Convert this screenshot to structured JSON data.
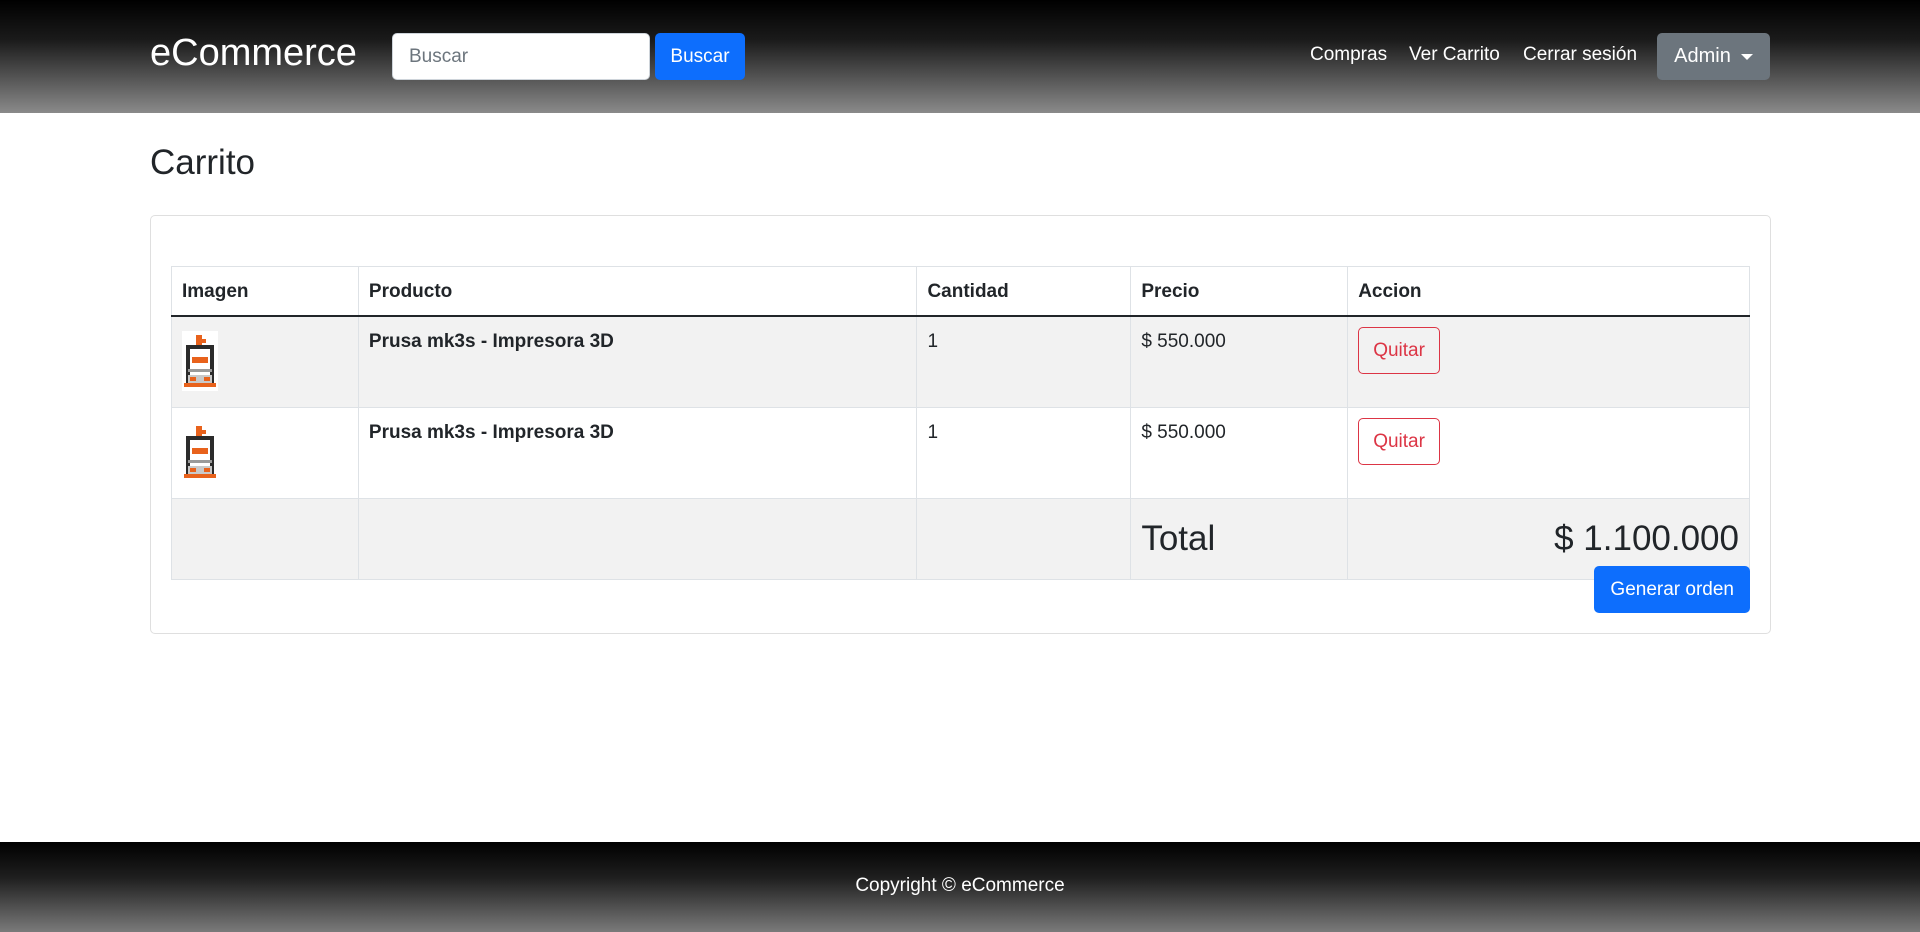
{
  "header": {
    "brand": "eCommerce",
    "search": {
      "placeholder": "Buscar",
      "value": "",
      "button_label": "Buscar"
    },
    "nav": {
      "purchases": "Compras",
      "view_cart": "Ver Carrito",
      "logout": "Cerrar sesión",
      "user_menu": "Admin"
    }
  },
  "page": {
    "title": "Carrito"
  },
  "cart": {
    "columns": [
      "Imagen",
      "Producto",
      "Cantidad",
      "Precio",
      "Accion"
    ],
    "rows": [
      {
        "image": "printer-thumbnail",
        "product": "Prusa mk3s - Impresora 3D",
        "quantity": "1",
        "price": "$ 550.000",
        "action": "Quitar"
      },
      {
        "image": "printer-thumbnail",
        "product": "Prusa mk3s - Impresora 3D",
        "quantity": "1",
        "price": "$ 550.000",
        "action": "Quitar"
      }
    ],
    "total_label": "Total",
    "total_value": "$ 1.100.000",
    "order_button": "Generar orden"
  },
  "footer": {
    "text": "Copyright © eCommerce"
  },
  "colors": {
    "primary": "#0d6efd",
    "danger": "#dc3545",
    "secondary": "#6c757d"
  }
}
